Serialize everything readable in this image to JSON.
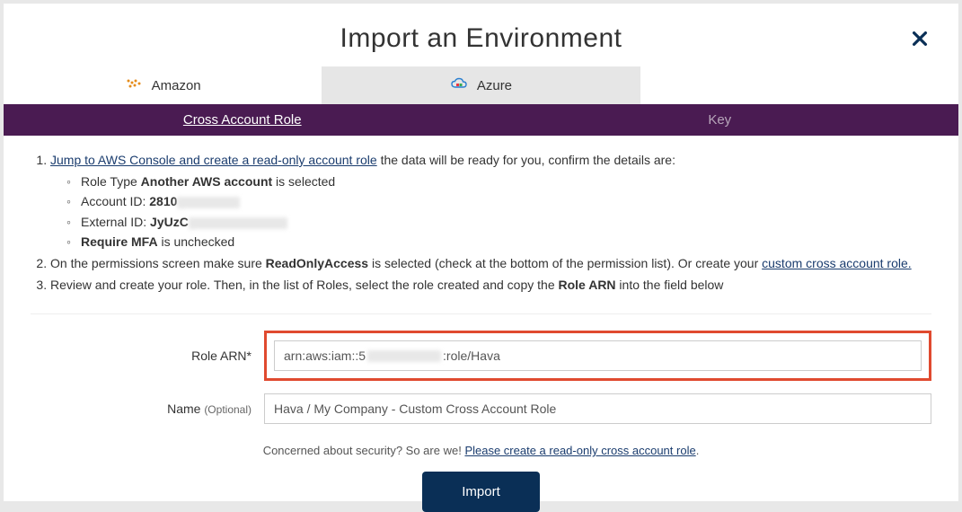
{
  "title": "Import an Environment",
  "providers": {
    "amazon": "Amazon",
    "azure": "Azure"
  },
  "subtabs": {
    "cross": "Cross Account Role",
    "key": "Key"
  },
  "step1": {
    "link": "Jump to AWS Console and create a read-only account role",
    "tail": " the data will be ready for you, confirm the details are:"
  },
  "bullets": {
    "roletype_pre": "Role Type ",
    "roletype_bold": "Another AWS account",
    "roletype_post": " is selected",
    "account_pre": "Account ID: ",
    "account_bold": "2810",
    "external_pre": "External ID: ",
    "external_bold": "JyUzC",
    "mfa_bold": "Require MFA",
    "mfa_post": " is unchecked"
  },
  "step2": {
    "pre": "On the permissions screen make sure ",
    "bold": "ReadOnlyAccess",
    "mid": " is selected (check at the bottom of the permission list). Or create your ",
    "link": "custom cross account role."
  },
  "step3": {
    "pre": "Review and create your role. Then, in the list of Roles, select the role created and copy the ",
    "bold": "Role ARN",
    "post": " into the field below"
  },
  "form": {
    "role_label": "Role ARN*",
    "role_value_pre": "arn:aws:iam::5",
    "role_value_post": ":role/Hava",
    "name_label": "Name ",
    "name_optional": "(Optional)",
    "name_value": "Hava / My Company - Custom Cross Account Role"
  },
  "security": {
    "pre": "Concerned about security? So are we! ",
    "link": "Please create a read-only cross account role",
    "post": "."
  },
  "import_btn": "Import"
}
